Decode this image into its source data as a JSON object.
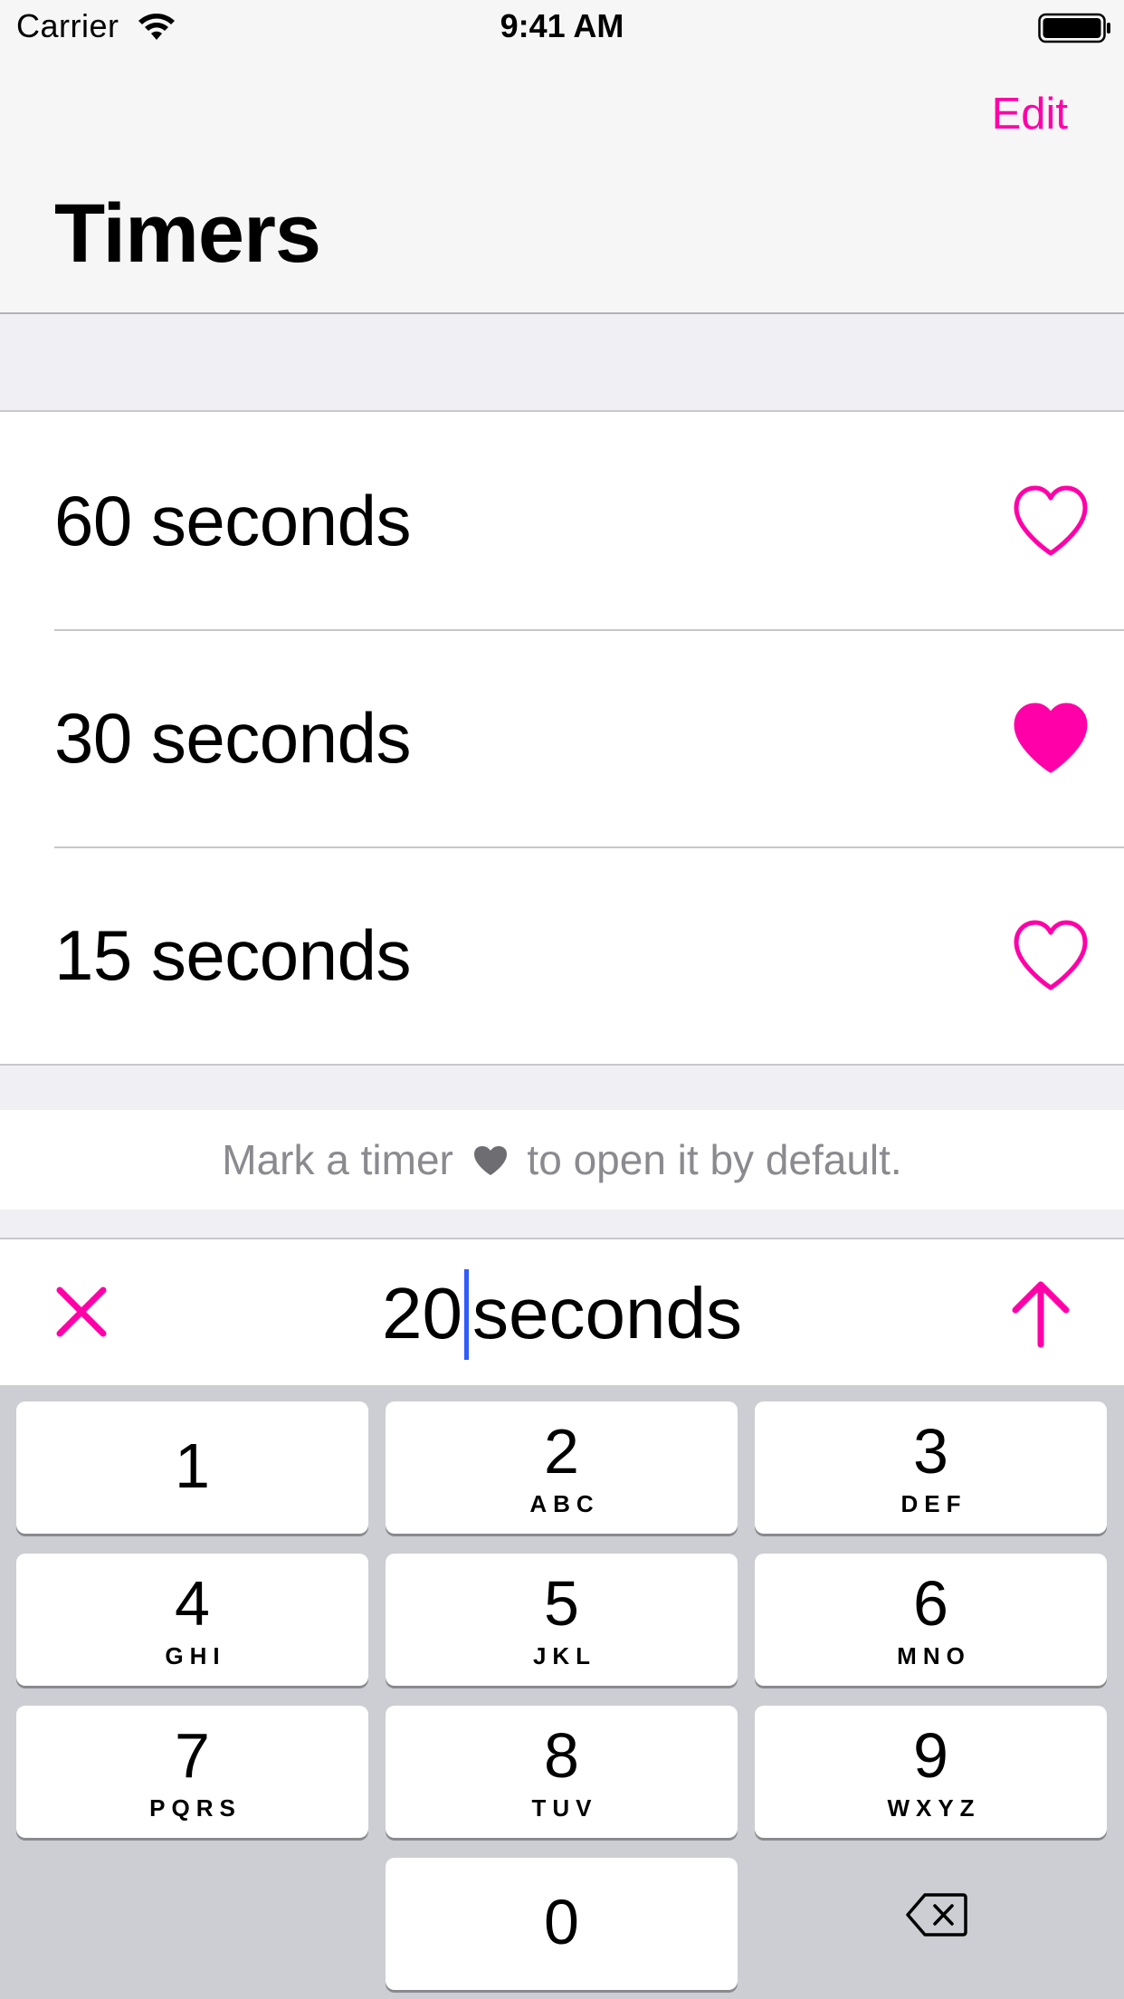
{
  "status_bar": {
    "carrier": "Carrier",
    "time": "9:41 AM"
  },
  "nav": {
    "edit_label": "Edit",
    "title": "Timers"
  },
  "timers": [
    {
      "label": "60 seconds",
      "favorite": false
    },
    {
      "label": "30 seconds",
      "favorite": true
    },
    {
      "label": "15 seconds",
      "favorite": false
    }
  ],
  "hint": {
    "before": "Mark a timer",
    "after": "to open it by default."
  },
  "input": {
    "value": "20",
    "suffix": "seconds"
  },
  "keypad": {
    "keys": [
      {
        "digit": "1",
        "letters": ""
      },
      {
        "digit": "2",
        "letters": "ABC"
      },
      {
        "digit": "3",
        "letters": "DEF"
      },
      {
        "digit": "4",
        "letters": "GHI"
      },
      {
        "digit": "5",
        "letters": "JKL"
      },
      {
        "digit": "6",
        "letters": "MNO"
      },
      {
        "digit": "7",
        "letters": "PQRS"
      },
      {
        "digit": "8",
        "letters": "TUV"
      },
      {
        "digit": "9",
        "letters": "WXYZ"
      },
      {
        "digit": "0",
        "letters": ""
      }
    ]
  },
  "colors": {
    "accent": "#ff00a8",
    "caret": "#2f5bff",
    "hint_text": "#8a8a8f",
    "hint_heart": "#6d6d72"
  }
}
